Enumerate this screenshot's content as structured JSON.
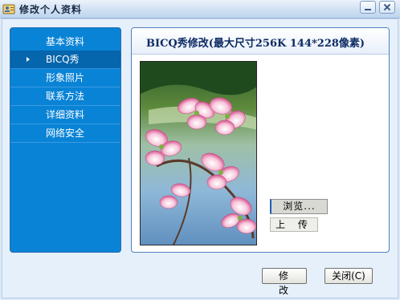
{
  "window": {
    "title": "修改个人资料",
    "icons": {
      "app": "user-card-icon",
      "minimize": "minimize-icon",
      "close": "close-icon"
    }
  },
  "sidebar": {
    "items": [
      {
        "label": "基本资料",
        "active": false
      },
      {
        "label": "BICQ秀",
        "active": true
      },
      {
        "label": "形象照片",
        "active": false
      },
      {
        "label": "联系方法",
        "active": false
      },
      {
        "label": "详细资料",
        "active": false
      },
      {
        "label": "网络安全",
        "active": false
      }
    ]
  },
  "panel": {
    "title": "BICQ秀修改(最大尺寸256K 144*228像素)",
    "browse_label": "浏览...",
    "upload_label": "上 传"
  },
  "footer": {
    "modify_label": "修 改",
    "close_label": "关闭(C)"
  },
  "colors": {
    "sidebar_bg": "#0983d6",
    "sidebar_active": "#0565ad",
    "panel_border": "#4f7fbf",
    "title_text": "#0d2a63"
  }
}
